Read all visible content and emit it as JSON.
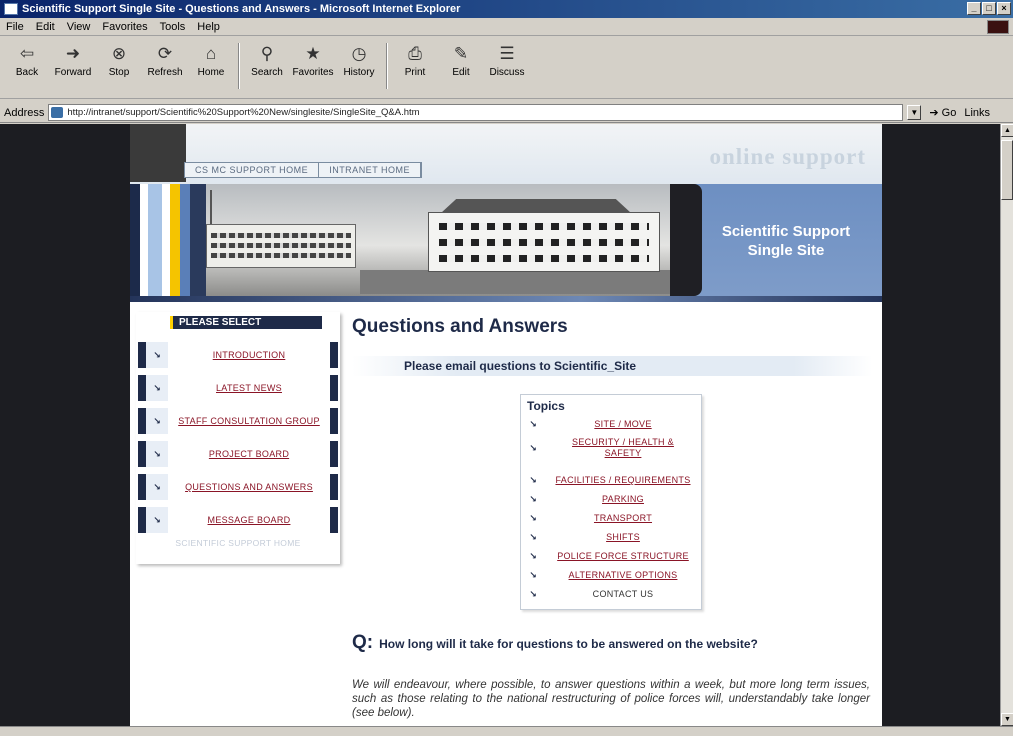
{
  "window": {
    "title": "Scientific Support Single Site - Questions and Answers - Microsoft Internet Explorer",
    "controls": [
      "_",
      "□",
      "×"
    ]
  },
  "menu": [
    "File",
    "Edit",
    "View",
    "Favorites",
    "Tools",
    "Help"
  ],
  "toolbar": {
    "buttons": [
      {
        "label": "Back",
        "icon": "back-arrow-icon",
        "glyph": "⇦"
      },
      {
        "label": "Forward",
        "icon": "forward-arrow-icon",
        "glyph": "➜"
      },
      {
        "label": "Stop",
        "icon": "stop-icon",
        "glyph": "⊗"
      },
      {
        "label": "Refresh",
        "icon": "refresh-icon",
        "glyph": "⟳"
      },
      {
        "label": "Home",
        "icon": "home-icon",
        "glyph": "⌂"
      },
      {
        "label": "Search",
        "icon": "search-icon",
        "glyph": "⚲"
      },
      {
        "label": "Favorites",
        "icon": "favorites-icon",
        "glyph": "★"
      },
      {
        "label": "History",
        "icon": "history-icon",
        "glyph": "◷"
      },
      {
        "label": "Print",
        "icon": "print-icon",
        "glyph": "⎙"
      },
      {
        "label": "Edit",
        "icon": "edit-icon",
        "glyph": "✎"
      },
      {
        "label": "Discuss",
        "icon": "discuss-icon",
        "glyph": "☰"
      }
    ]
  },
  "address": {
    "label": "Address",
    "url": "http://intranet/support/Scientific%20Support%20New/singlesite/SingleSite_Q&A.htm",
    "go": "Go",
    "links": "Links"
  },
  "banner": {
    "wordmark": "online support",
    "tabs": [
      "CS MC SUPPORT HOME",
      "INTRANET HOME"
    ],
    "title_line1": "Scientific Support",
    "title_line2": "Single Site"
  },
  "sidebar": {
    "header": "PLEASE SELECT",
    "arrow": "↘",
    "items": [
      {
        "label": "INTRODUCTION"
      },
      {
        "label": "LATEST NEWS"
      },
      {
        "label": "STAFF CONSULTATION GROUP"
      },
      {
        "label": "PROJECT BOARD"
      },
      {
        "label": "QUESTIONS AND ANSWERS"
      },
      {
        "label": "MESSAGE BOARD"
      }
    ],
    "footer_link": "SCIENTIFIC SUPPORT HOME"
  },
  "main": {
    "heading": "Questions and Answers",
    "email_text": "Please email questions to Scientific_Site",
    "topics_title": "Topics",
    "topics": [
      {
        "label": "SITE / MOVE"
      },
      {
        "label": "SECURITY / HEALTH & SAFETY"
      },
      {
        "label": "FACILITIES / REQUIREMENTS"
      },
      {
        "label": "PARKING"
      },
      {
        "label": "TRANSPORT"
      },
      {
        "label": "SHIFTS"
      },
      {
        "label": "POLICE FORCE STRUCTURE"
      },
      {
        "label": "ALTERNATIVE OPTIONS"
      },
      {
        "label": "CONTACT US"
      }
    ],
    "question_marker": "Q:",
    "question": "How long will it take for questions to be answered on the website?",
    "answer": "We will endeavour, where possible, to answer questions within a week, but more long term issues, such as those relating to the national restructuring of police forces will, understandably take longer (see below)."
  }
}
